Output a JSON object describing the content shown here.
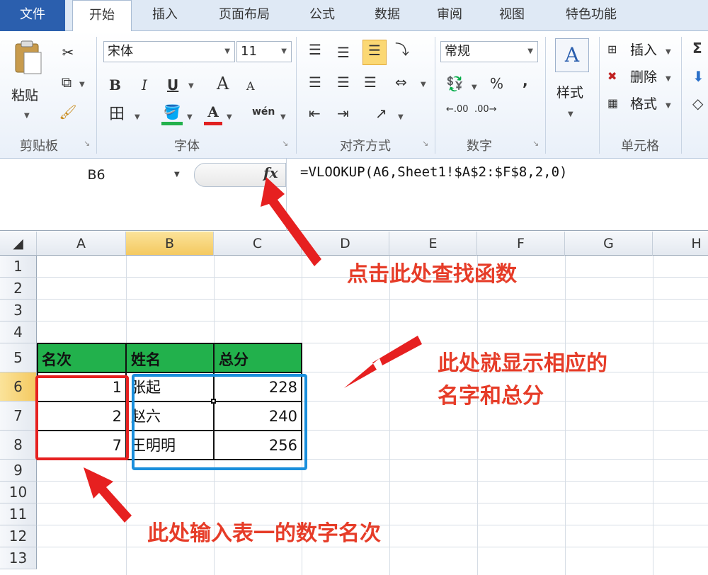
{
  "tabs": [
    "文件",
    "开始",
    "插入",
    "页面布局",
    "公式",
    "数据",
    "审阅",
    "视图",
    "特色功能"
  ],
  "ribbon": {
    "clipboard": {
      "paste_label": "粘贴",
      "group_label": "剪贴板"
    },
    "font": {
      "font_name": "宋体",
      "font_size": "11",
      "group_label": "字体",
      "bold": "B",
      "italic": "I",
      "underline": "U",
      "grow": "A",
      "shrink": "A",
      "font_color_glyph": "A",
      "phonetic": "wén"
    },
    "alignment": {
      "group_label": "对齐方式"
    },
    "number": {
      "format": "常规",
      "percent": "%",
      "comma": ",",
      "inc_decimal": ".00",
      "dec_decimal": ".00",
      "group_label": "数字"
    },
    "styles": {
      "label": "样式"
    },
    "cells": {
      "insert": "插入",
      "delete": "删除",
      "format": "格式",
      "group_label": "单元格"
    },
    "editing": {
      "sigma": "Σ"
    }
  },
  "formula_bar": {
    "name_box": "B6",
    "fx": "fx",
    "formula": "=VLOOKUP(A6,Sheet1!$A$2:$F$8,2,0)"
  },
  "columns": [
    "A",
    "B",
    "C",
    "D",
    "E",
    "F",
    "G",
    "H"
  ],
  "rows": [
    "1",
    "2",
    "3",
    "4",
    "5",
    "6",
    "7",
    "8",
    "9",
    "10",
    "11",
    "12",
    "13"
  ],
  "table": {
    "headers": [
      "名次",
      "姓名",
      "总分"
    ],
    "rows": [
      {
        "rank": "1",
        "name": "张起",
        "score": "228"
      },
      {
        "rank": "2",
        "name": "赵六",
        "score": "240"
      },
      {
        "rank": "7",
        "name": "王明明",
        "score": "256"
      }
    ]
  },
  "annotations": {
    "fx_note": "点击此处查找函数",
    "result_note_line1": "此处就显示相应的",
    "result_note_line2": "名字和总分",
    "input_note": "此处输入表一的数字名次"
  },
  "colors": {
    "header_green": "#22b14c",
    "annotation_red": "#e63c28",
    "result_blue": "#1a8fdc"
  }
}
